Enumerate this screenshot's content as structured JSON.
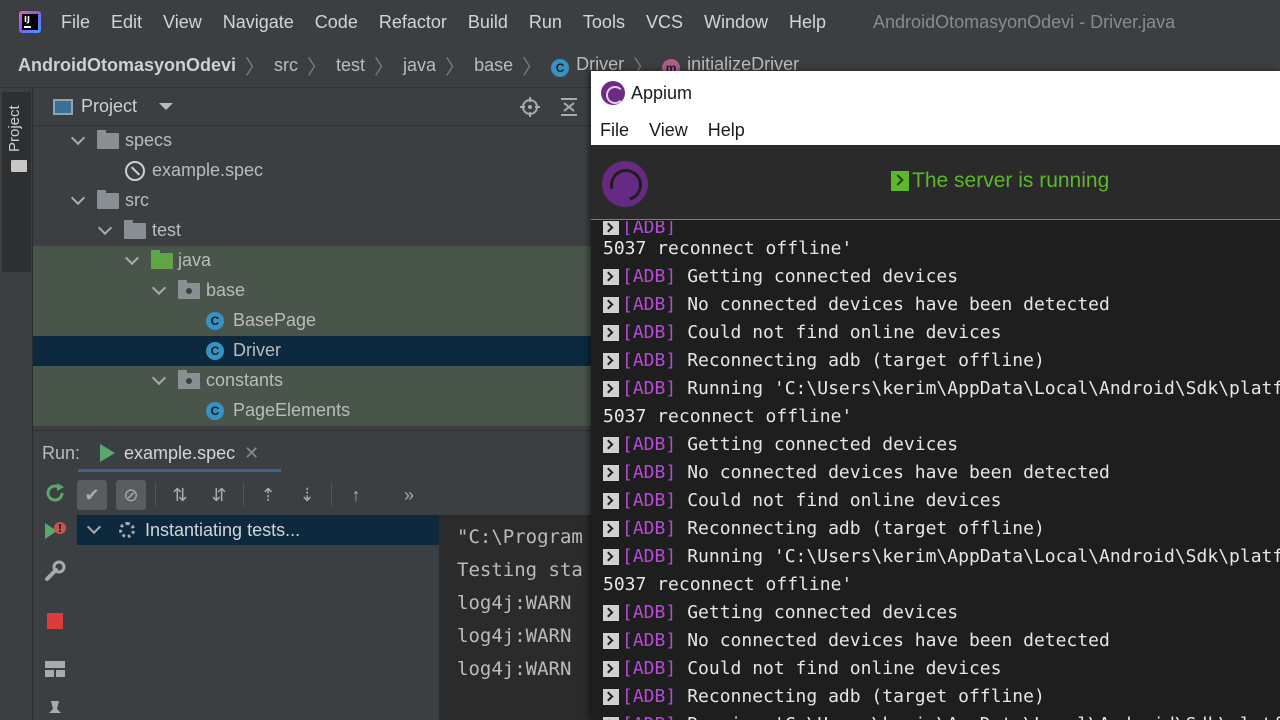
{
  "ide": {
    "menu": [
      "File",
      "Edit",
      "View",
      "Navigate",
      "Code",
      "Refactor",
      "Build",
      "Run",
      "Tools",
      "VCS",
      "Window",
      "Help"
    ],
    "window_title": "AndroidOtomasyonOdevi - Driver.java",
    "breadcrumb": {
      "project": "AndroidOtomasyonOdevi",
      "items": [
        "src",
        "test",
        "java",
        "base"
      ],
      "class": "Driver",
      "method": "initializeDriver",
      "class_badge": "C",
      "method_badge": "m"
    },
    "tool_stripe_label": "Project",
    "project_panel": {
      "title": "Project",
      "tree": [
        "specs",
        "example.spec",
        "src",
        "test",
        "java",
        "base",
        "BasePage",
        "Driver",
        "constants",
        "PageElements"
      ],
      "class_badge": "C"
    },
    "run_panel": {
      "label": "Run:",
      "tab": "example.spec",
      "close_glyph": "✕",
      "status_row": "Instantiating tests...",
      "console": [
        "\"C:\\Program",
        "Testing sta",
        "log4j:WARN",
        "log4j:WARN",
        "log4j:WARN"
      ]
    }
  },
  "appium": {
    "title": "Appium",
    "menu": [
      "File",
      "View",
      "Help"
    ],
    "status": "The server is running",
    "log": {
      "first_line": "5037 reconnect offline'",
      "tag": "[ADB]",
      "lines": [
        "Getting connected devices",
        "No connected devices have been detected",
        "Could not find online devices",
        "Reconnecting adb (target offline)",
        "Running 'C:\\Users\\kerim\\AppData\\Local\\Android\\Sdk\\platf",
        "5037 reconnect offline'",
        "Getting connected devices",
        "No connected devices have been detected",
        "Could not find online devices",
        "Reconnecting adb (target offline)",
        "Running 'C:\\Users\\kerim\\AppData\\Local\\Android\\Sdk\\platf",
        "5037 reconnect offline'",
        "Getting connected devices",
        "No connected devices have been detected",
        "Could not find online devices",
        "Reconnecting adb (target offline)",
        "Running 'C:\\Users\\kerim\\AppData\\Local\\Android\\Sdk\\platf"
      ]
    }
  },
  "colors": {
    "adb_tag": "#b54bd6",
    "server_running": "#5cb82a",
    "selection": "#0d293e",
    "test_scope": "#49544a"
  }
}
